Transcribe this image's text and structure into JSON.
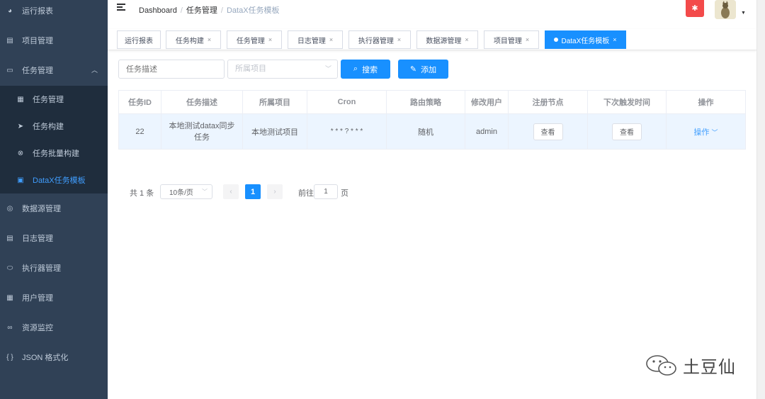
{
  "sidebar": {
    "items": [
      {
        "label": "运行报表",
        "icon": "dashboard-icon"
      },
      {
        "label": "项目管理",
        "icon": "project-icon"
      },
      {
        "label": "任务管理",
        "icon": "monitor-icon",
        "expanded": true
      },
      {
        "label": "任务管理",
        "icon": "task-list-icon"
      },
      {
        "label": "任务构建",
        "icon": "send-icon"
      },
      {
        "label": "任务批量构建",
        "icon": "batch-icon"
      },
      {
        "label": "DataX任务模板",
        "icon": "template-icon",
        "active": true
      },
      {
        "label": "数据源管理",
        "icon": "database-icon"
      },
      {
        "label": "日志管理",
        "icon": "log-icon"
      },
      {
        "label": "执行器管理",
        "icon": "executor-icon"
      },
      {
        "label": "用户管理",
        "icon": "user-table-icon"
      },
      {
        "label": "资源监控",
        "icon": "monitor-glasses-icon"
      },
      {
        "label": "JSON 格式化",
        "icon": "json-braces-icon"
      }
    ]
  },
  "navbar": {
    "breadcrumb": [
      "Dashboard",
      "任务管理",
      "DataX任务模板"
    ],
    "bug_icon": "bug-icon"
  },
  "tags": [
    {
      "label": "运行报表",
      "closable": false
    },
    {
      "label": "任务构建",
      "closable": true
    },
    {
      "label": "任务管理",
      "closable": true
    },
    {
      "label": "日志管理",
      "closable": true
    },
    {
      "label": "执行器管理",
      "closable": true
    },
    {
      "label": "数据源管理",
      "closable": true
    },
    {
      "label": "项目管理",
      "closable": true
    },
    {
      "label": "DataX任务模板",
      "closable": true,
      "active": true
    }
  ],
  "filters": {
    "task_desc_placeholder": "任务描述",
    "project_placeholder": "所属项目",
    "search_label": "搜索",
    "add_label": "添加"
  },
  "table": {
    "columns": [
      "任务ID",
      "任务描述",
      "所属项目",
      "Cron",
      "路由策略",
      "修改用户",
      "注册节点",
      "下次触发时间",
      "操作"
    ],
    "rows": [
      {
        "id": "22",
        "desc": "本地测试datax同步任务",
        "project": "本地测试项目",
        "cron": "* * * ? * * *",
        "route": "随机",
        "user": "admin",
        "nodes_btn": "查看",
        "next_btn": "查看",
        "op": "操作"
      }
    ]
  },
  "pagination": {
    "total_text": "共 1 条",
    "page_size": "10条/页",
    "current_page": "1",
    "goto_label": "前往",
    "goto_value": "1",
    "page_suffix": "页"
  },
  "watermark": {
    "text": "土豆仙"
  },
  "colors": {
    "primary": "#1890ff",
    "sidebar_bg": "#304156",
    "submenu_bg": "#1f2d3d",
    "active_text": "#409eff",
    "bug_red": "#f34a4a"
  }
}
